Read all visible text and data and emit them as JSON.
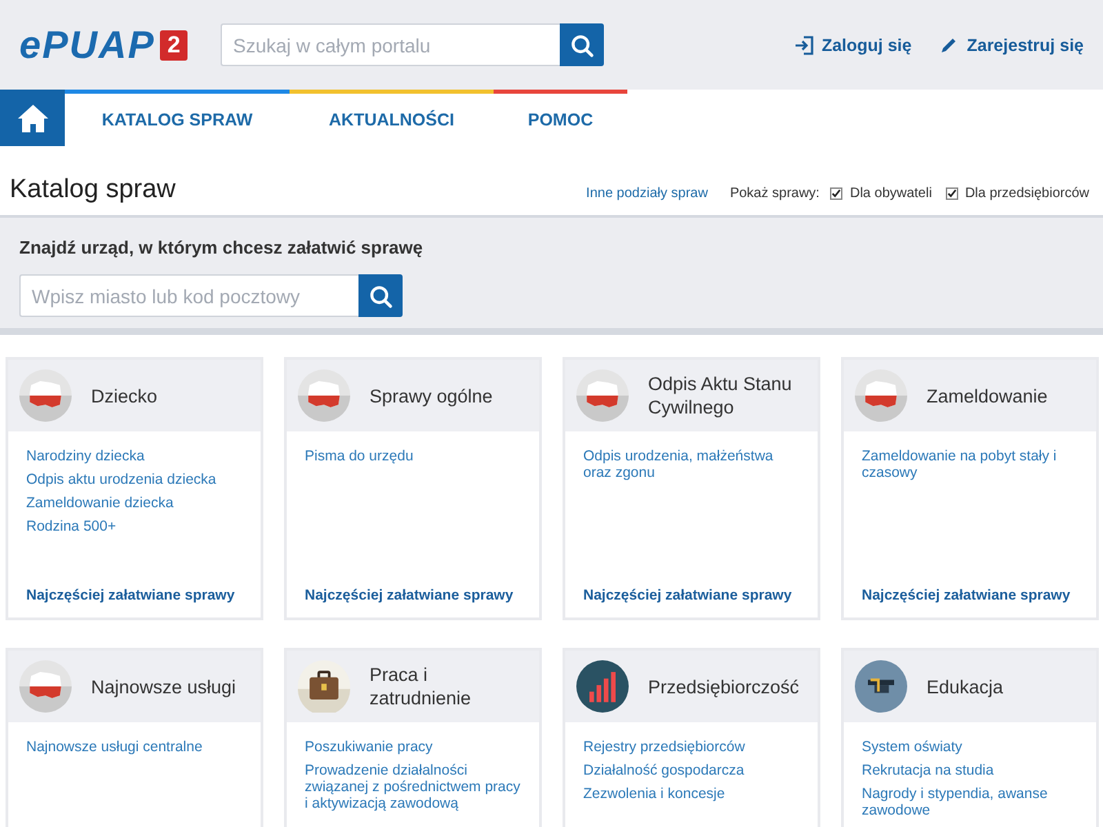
{
  "header": {
    "logo_text": "ePUAP",
    "logo_badge": "2",
    "search": {
      "placeholder": "Szukaj w całym portalu"
    },
    "login": "Zaloguj się",
    "register": "Zarejestruj się"
  },
  "nav": {
    "tabs": [
      {
        "label": "KATALOG SPRAW",
        "color": "#1e88e5"
      },
      {
        "label": "AKTUALNOŚCI",
        "color": "#f2c12e"
      },
      {
        "label": "POMOC",
        "color": "#e8453c"
      }
    ]
  },
  "page": {
    "title": "Katalog spraw",
    "other_link": "Inne podziały spraw",
    "show_label": "Pokaż sprawy:",
    "filters": [
      {
        "label": "Dla obywateli",
        "checked": true
      },
      {
        "label": "Dla przedsiębiorców",
        "checked": true
      }
    ]
  },
  "office_search": {
    "heading": "Znajdź urząd, w którym chcesz załatwić sprawę",
    "placeholder": "Wpisz miasto lub kod pocztowy"
  },
  "cards": [
    {
      "kind": "map",
      "title": "Dziecko",
      "links": [
        "Narodziny dziecka",
        "Odpis aktu urodzenia dziecka",
        "Zameldowanie dziecka",
        "Rodzina 500+"
      ],
      "footer": "Najczęściej załatwiane sprawy"
    },
    {
      "kind": "map",
      "title": "Sprawy ogólne",
      "links": [
        "Pisma do urzędu"
      ],
      "footer": "Najczęściej załatwiane sprawy"
    },
    {
      "kind": "map",
      "title": "Odpis Aktu Stanu Cywilnego",
      "links": [
        "Odpis urodzenia, małżeństwa oraz zgonu"
      ],
      "footer": "Najczęściej załatwiane sprawy"
    },
    {
      "kind": "map",
      "title": "Zameldowanie",
      "links": [
        "Zameldowanie na pobyt stały i czasowy"
      ],
      "footer": "Najczęściej załatwiane sprawy"
    },
    {
      "kind": "map",
      "title": "Najnowsze usługi",
      "links": [
        "Najnowsze usługi centralne"
      ]
    },
    {
      "kind": "briefcase",
      "title": "Praca i zatrudnienie",
      "links": [
        "Poszukiwanie pracy",
        "Prowadzenie działalności związanej z pośrednictwem pracy i aktywizacją zawodową"
      ]
    },
    {
      "kind": "chart",
      "title": "Przedsiębiorczość",
      "links": [
        "Rejestry przedsiębiorców",
        "Działalność gospodarcza",
        "Zezwolenia i koncesje"
      ]
    },
    {
      "kind": "cap",
      "title": "Edukacja",
      "links": [
        "System oświaty",
        "Rekrutacja na studia",
        "Nagrody i stypendia, awanse zawodowe"
      ]
    }
  ]
}
